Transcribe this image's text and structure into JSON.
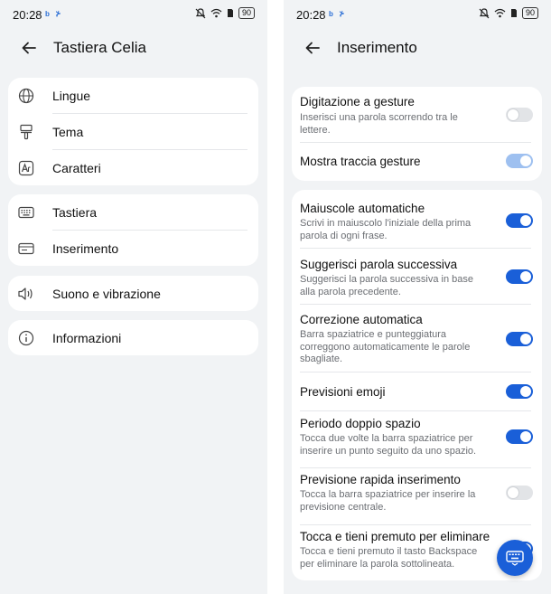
{
  "status_bar": {
    "time": "20:28",
    "apps": "b ⊁",
    "battery": "90"
  },
  "left": {
    "title": "Tastiera Celia",
    "groups": [
      {
        "items": [
          {
            "label": "Lingue",
            "icon": "globe-icon"
          },
          {
            "label": "Tema",
            "icon": "paintbrush-icon"
          },
          {
            "label": "Caratteri",
            "icon": "font-icon"
          }
        ]
      },
      {
        "items": [
          {
            "label": "Tastiera",
            "icon": "keyboard-icon"
          },
          {
            "label": "Inserimento",
            "icon": "input-icon"
          }
        ]
      },
      {
        "items": [
          {
            "label": "Suono e vibrazione",
            "icon": "speaker-icon"
          }
        ]
      },
      {
        "items": [
          {
            "label": "Informazioni",
            "icon": "info-icon"
          }
        ]
      }
    ]
  },
  "right": {
    "title": "Inserimento",
    "group1": [
      {
        "title": "Digitazione a gesture",
        "desc": "Inserisci una parola scorrendo tra le lettere.",
        "state": "off"
      },
      {
        "title": "Mostra traccia gesture",
        "desc": "",
        "state": "dim"
      }
    ],
    "group2": [
      {
        "title": "Maiuscole automatiche",
        "desc": "Scrivi in maiuscolo l'iniziale della prima parola di ogni frase.",
        "state": "on"
      },
      {
        "title": "Suggerisci parola successiva",
        "desc": "Suggerisci la parola successiva in base alla parola precedente.",
        "state": "on"
      },
      {
        "title": "Correzione automatica",
        "desc": "Barra spaziatrice e punteggiatura correggono automaticamente le parole sbagliate.",
        "state": "on"
      },
      {
        "title": "Previsioni emoji",
        "desc": "",
        "state": "on"
      },
      {
        "title": "Periodo doppio spazio",
        "desc": "Tocca due volte la barra spaziatrice per inserire un punto seguito da uno spazio.",
        "state": "on"
      },
      {
        "title": "Previsione rapida inserimento",
        "desc": "Tocca la barra spaziatrice per inserire la previsione centrale.",
        "state": "off"
      },
      {
        "title": "Tocca e tieni premuto per eliminare",
        "desc": "Tocca e tieni premuto il tasto Backspace per eliminare la parola sottolineata.",
        "state": "on"
      }
    ]
  },
  "colors": {
    "accent": "#1a5fd8",
    "background": "#f1f3f5",
    "card": "#ffffff"
  }
}
